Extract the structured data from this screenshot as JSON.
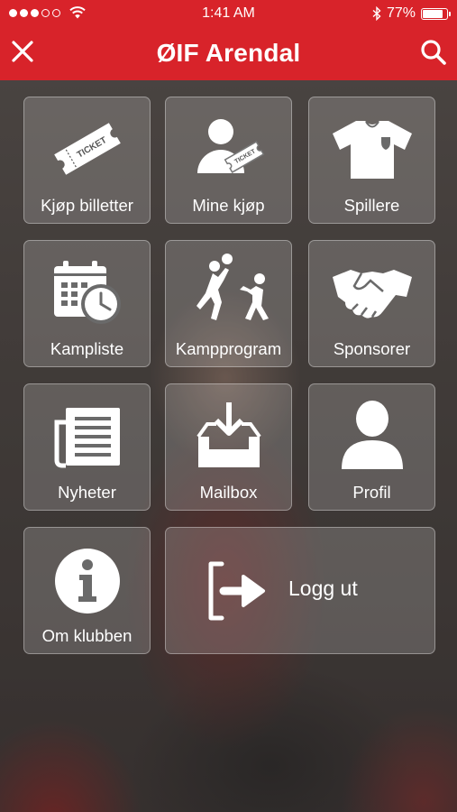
{
  "status_bar": {
    "time": "1:41 AM",
    "battery": "77%",
    "battery_level": 0.77
  },
  "header": {
    "title": "ØIF Arendal",
    "close_icon": "close-icon",
    "search_icon": "search-icon"
  },
  "tiles": [
    {
      "label": "Kjøp billetter",
      "icon": "ticket-icon"
    },
    {
      "label": "Mine kjøp",
      "icon": "user-ticket-icon"
    },
    {
      "label": "Spillere",
      "icon": "jersey-icon"
    },
    {
      "label": "Kampliste",
      "icon": "calendar-clock-icon"
    },
    {
      "label": "Kampprogram",
      "icon": "players-icon"
    },
    {
      "label": "Sponsorer",
      "icon": "handshake-icon"
    },
    {
      "label": "Nyheter",
      "icon": "newspaper-icon"
    },
    {
      "label": "Mailbox",
      "icon": "inbox-download-icon"
    },
    {
      "label": "Profil",
      "icon": "person-icon"
    },
    {
      "label": "Om klubben",
      "icon": "info-icon"
    },
    {
      "label": "Logg ut",
      "icon": "logout-icon"
    }
  ],
  "colors": {
    "brand_red": "#d8232a",
    "tile_bg": "rgba(255,255,255,0.18)"
  }
}
